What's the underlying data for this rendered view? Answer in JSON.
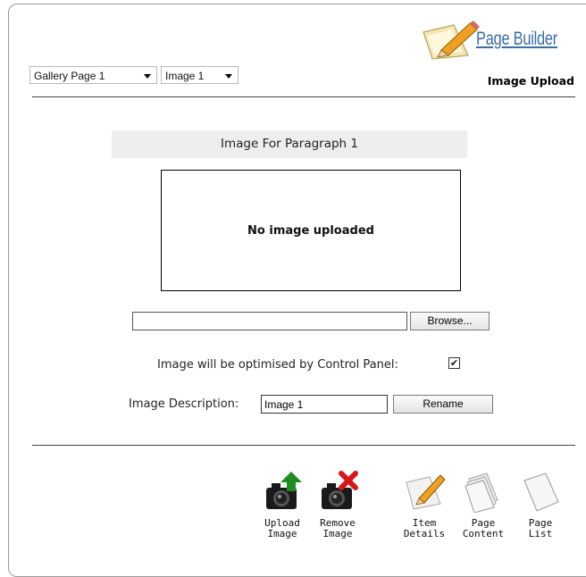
{
  "header": {
    "logo_text": "Page Builder",
    "section_title": "Image Upload",
    "page_select": {
      "selected": "Gallery Page 1"
    },
    "image_select": {
      "selected": "Image 1"
    }
  },
  "main": {
    "heading": "Image For Paragraph 1",
    "image_placeholder": "No image uploaded",
    "file_input_value": "",
    "browse_label": "Browse...",
    "optimise_label": "Image will be optimised by Control Panel:",
    "optimise_checked": "✔",
    "description_label": "Image Description:",
    "description_value": "Image 1",
    "rename_label": "Rename"
  },
  "toolbar": {
    "upload": "Upload\nImage",
    "remove": "Remove\nImage",
    "item_details": "Item\nDetails",
    "page_content": "Page\nContent",
    "page_list": "Page\nList"
  },
  "colors": {
    "link": "#3a6ea5",
    "upload_arrow": "#1e8c1e",
    "remove_x": "#d81818"
  }
}
